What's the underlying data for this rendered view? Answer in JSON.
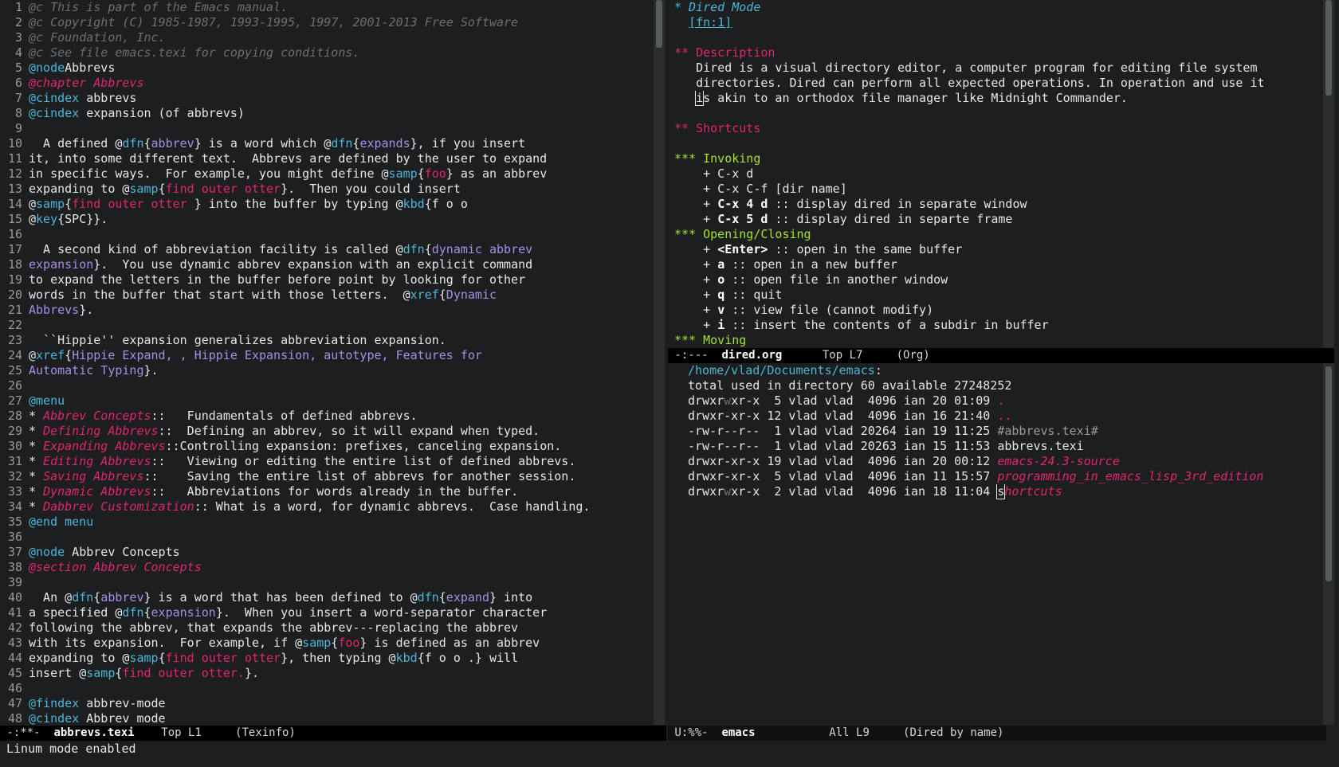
{
  "left_buffer": {
    "name": "abbrevs.texi",
    "lines": [
      [
        [
          "c-comment",
          "@c This is part of the Emacs manual."
        ]
      ],
      [
        [
          "c-comment",
          "@c Copyright (C) 1985-1987, 1993-1995, 1997, 2001-2013 Free Software"
        ]
      ],
      [
        [
          "c-comment",
          "@c Foundation, Inc."
        ]
      ],
      [
        [
          "c-comment",
          "@c See file emacs.texi for copying conditions."
        ]
      ],
      [
        [
          "c-cmd",
          "@node"
        ],
        [
          "",
          "Abbrevs"
        ]
      ],
      [
        [
          "c-chapter",
          "@chapter Abbrevs"
        ]
      ],
      [
        [
          "c-cmd",
          "@cindex"
        ],
        [
          "",
          " abbrevs"
        ]
      ],
      [
        [
          "c-cmd",
          "@cindex"
        ],
        [
          "",
          " expansion (of abbrevs)"
        ]
      ],
      [
        [
          "",
          ""
        ]
      ],
      [
        [
          "",
          "  A defined @"
        ],
        [
          "c-cmd",
          "dfn"
        ],
        [
          "",
          "{"
        ],
        [
          "c-arg",
          "abbrev"
        ],
        [
          "",
          "} is a word which @"
        ],
        [
          "c-cmd",
          "dfn"
        ],
        [
          "",
          "{"
        ],
        [
          "c-arg",
          "expands"
        ],
        [
          "",
          "}, if you insert"
        ]
      ],
      [
        [
          "",
          "it, into some different text.  Abbrevs are defined by the user to expand"
        ]
      ],
      [
        [
          "",
          "in specific ways.  For example, you might define @"
        ],
        [
          "c-cmd",
          "samp"
        ],
        [
          "",
          "{"
        ],
        [
          "c-str",
          "foo"
        ],
        [
          "",
          "} as an abbrev"
        ]
      ],
      [
        [
          "",
          "expanding to @"
        ],
        [
          "c-cmd",
          "samp"
        ],
        [
          "",
          "{"
        ],
        [
          "c-str",
          "find outer otter"
        ],
        [
          "",
          "}.  Then you could insert"
        ]
      ],
      [
        [
          "",
          "@"
        ],
        [
          "c-cmd",
          "samp"
        ],
        [
          "",
          "{"
        ],
        [
          "c-str",
          "find outer otter "
        ],
        [
          "",
          "} into the buffer by typing @"
        ],
        [
          "c-cmd",
          "kbd"
        ],
        [
          "",
          "{f o o"
        ]
      ],
      [
        [
          "",
          "@"
        ],
        [
          "c-cmd",
          "key"
        ],
        [
          "",
          "{SPC}}."
        ]
      ],
      [
        [
          "",
          ""
        ]
      ],
      [
        [
          "",
          "  A second kind of abbreviation facility is called @"
        ],
        [
          "c-cmd",
          "dfn"
        ],
        [
          "",
          "{"
        ],
        [
          "c-arg",
          "dynamic abbrev"
        ]
      ],
      [
        [
          "c-arg",
          "expansion"
        ],
        [
          "",
          "}.  You use dynamic abbrev expansion with an explicit command"
        ]
      ],
      [
        [
          "",
          "to expand the letters in the buffer before point by looking for other"
        ]
      ],
      [
        [
          "",
          "words in the buffer that start with those letters.  @"
        ],
        [
          "c-cmd",
          "xref"
        ],
        [
          "",
          "{"
        ],
        [
          "c-arg",
          "Dynamic"
        ]
      ],
      [
        [
          "c-arg",
          "Abbrevs"
        ],
        [
          "",
          "}."
        ]
      ],
      [
        [
          "",
          ""
        ]
      ],
      [
        [
          "",
          "  ``Hippie'' expansion generalizes abbreviation expansion."
        ]
      ],
      [
        [
          "",
          "@"
        ],
        [
          "c-cmd",
          "xref"
        ],
        [
          "",
          "{"
        ],
        [
          "c-arg",
          "Hippie Expand, , Hippie Expansion, autotype, Features for"
        ]
      ],
      [
        [
          "c-arg",
          "Automatic Typing"
        ],
        [
          "",
          "}."
        ]
      ],
      [
        [
          "",
          ""
        ]
      ],
      [
        [
          "c-cmd",
          "@menu"
        ]
      ],
      [
        [
          "",
          "* "
        ],
        [
          "c-menu-item",
          "Abbrev Concepts"
        ],
        [
          "",
          "::   Fundamentals of defined abbrevs."
        ]
      ],
      [
        [
          "",
          "* "
        ],
        [
          "c-menu-item",
          "Defining Abbrevs"
        ],
        [
          "",
          "::  Defining an abbrev, so it will expand when typed."
        ]
      ],
      [
        [
          "",
          "* "
        ],
        [
          "c-menu-item",
          "Expanding Abbrevs"
        ],
        [
          "",
          "::Controlling expansion: prefixes, canceling expansion."
        ]
      ],
      [
        [
          "",
          "* "
        ],
        [
          "c-menu-item",
          "Editing Abbrevs"
        ],
        [
          "",
          "::   Viewing or editing the entire list of defined abbrevs."
        ]
      ],
      [
        [
          "",
          "* "
        ],
        [
          "c-menu-item",
          "Saving Abbrevs"
        ],
        [
          "",
          "::    Saving the entire list of abbrevs for another session."
        ]
      ],
      [
        [
          "",
          "* "
        ],
        [
          "c-menu-item",
          "Dynamic Abbrevs"
        ],
        [
          "",
          "::   Abbreviations for words already in the buffer."
        ]
      ],
      [
        [
          "",
          "* "
        ],
        [
          "c-menu-item",
          "Dabbrev Customization"
        ],
        [
          "",
          ":: What is a word, for dynamic abbrevs.  Case handling."
        ]
      ],
      [
        [
          "c-cmd",
          "@end"
        ],
        [
          "",
          " "
        ],
        [
          "c-cmd",
          "menu"
        ]
      ],
      [
        [
          "",
          ""
        ]
      ],
      [
        [
          "c-cmd",
          "@node"
        ],
        [
          "",
          " Abbrev Concepts"
        ]
      ],
      [
        [
          "c-chapter",
          "@section Abbrev Concepts"
        ]
      ],
      [
        [
          "",
          ""
        ]
      ],
      [
        [
          "",
          "  An @"
        ],
        [
          "c-cmd",
          "dfn"
        ],
        [
          "",
          "{"
        ],
        [
          "c-arg",
          "abbrev"
        ],
        [
          "",
          "} is a word that has been defined to @"
        ],
        [
          "c-cmd",
          "dfn"
        ],
        [
          "",
          "{"
        ],
        [
          "c-arg",
          "expand"
        ],
        [
          "",
          "} into"
        ]
      ],
      [
        [
          "",
          "a specified @"
        ],
        [
          "c-cmd",
          "dfn"
        ],
        [
          "",
          "{"
        ],
        [
          "c-arg",
          "expansion"
        ],
        [
          "",
          "}.  When you insert a word-separator character"
        ]
      ],
      [
        [
          "",
          "following the abbrev, that expands the abbrev---replacing the abbrev"
        ]
      ],
      [
        [
          "",
          "with its expansion.  For example, if @"
        ],
        [
          "c-cmd",
          "samp"
        ],
        [
          "",
          "{"
        ],
        [
          "c-str",
          "foo"
        ],
        [
          "",
          "} is defined as an abbrev"
        ]
      ],
      [
        [
          "",
          "expanding to @"
        ],
        [
          "c-cmd",
          "samp"
        ],
        [
          "",
          "{"
        ],
        [
          "c-str",
          "find outer otter"
        ],
        [
          "",
          "}, then typing @"
        ],
        [
          "c-cmd",
          "kbd"
        ],
        [
          "",
          "{f o o .} will"
        ]
      ],
      [
        [
          "",
          "insert @"
        ],
        [
          "c-cmd",
          "samp"
        ],
        [
          "",
          "{"
        ],
        [
          "c-str",
          "find outer otter."
        ],
        [
          "",
          "}."
        ]
      ],
      [
        [
          "",
          ""
        ]
      ],
      [
        [
          "c-cmd",
          "@findex"
        ],
        [
          "",
          " abbrev-mode"
        ]
      ],
      [
        [
          "c-cmd",
          "@cindex"
        ],
        [
          "",
          " Abbrev mode"
        ]
      ]
    ]
  },
  "org_buffer": {
    "name": "dired.org",
    "lines": [
      [
        [
          "o-h1",
          "* Dired Mode"
        ]
      ],
      [
        [
          "",
          "  "
        ],
        [
          "o-link",
          "[fn:1]"
        ]
      ],
      [
        [
          "",
          ""
        ]
      ],
      [
        [
          "o-h2",
          "** Description"
        ]
      ],
      [
        [
          "",
          "   Dired is a visual directory editor, a computer program for editing file system"
        ]
      ],
      [
        [
          "",
          "   directories. Dired can perform all expected operations. In operation and use it"
        ]
      ],
      [
        [
          "",
          "   "
        ],
        [
          "cursor",
          "i"
        ],
        [
          "",
          "s akin to an orthodox file manager like Midnight Commander."
        ]
      ],
      [
        [
          "",
          ""
        ]
      ],
      [
        [
          "o-h2",
          "** Shortcuts"
        ]
      ],
      [
        [
          "",
          ""
        ]
      ],
      [
        [
          "o-h3",
          "*** Invoking"
        ]
      ],
      [
        [
          "",
          "    + C-x d"
        ]
      ],
      [
        [
          "",
          "    + C-x C-f [dir name]"
        ]
      ],
      [
        [
          "",
          "    + "
        ],
        [
          "bold",
          "C-x 4 d"
        ],
        [
          "",
          " :: display dired in separate window"
        ]
      ],
      [
        [
          "",
          "    + "
        ],
        [
          "bold",
          "C-x 5 d"
        ],
        [
          "",
          " :: display dired in separte frame"
        ]
      ],
      [
        [
          "o-h3",
          "*** Opening/Closing"
        ]
      ],
      [
        [
          "",
          "    + "
        ],
        [
          "bold",
          "<Enter>"
        ],
        [
          "",
          " :: open in the same buffer"
        ]
      ],
      [
        [
          "",
          "    + "
        ],
        [
          "bold",
          "a"
        ],
        [
          "",
          " :: open in a new buffer"
        ]
      ],
      [
        [
          "",
          "    + "
        ],
        [
          "bold",
          "o"
        ],
        [
          "",
          " :: open file in another window"
        ]
      ],
      [
        [
          "",
          "    + "
        ],
        [
          "bold",
          "q"
        ],
        [
          "",
          " :: quit"
        ]
      ],
      [
        [
          "",
          "    + "
        ],
        [
          "bold",
          "v"
        ],
        [
          "",
          " :: view file (cannot modify)"
        ]
      ],
      [
        [
          "",
          "    + "
        ],
        [
          "bold",
          "i"
        ],
        [
          "",
          " :: insert the contents of a subdir in buffer"
        ]
      ],
      [
        [
          "o-h3",
          "*** Moving"
        ]
      ]
    ]
  },
  "dired_buffer": {
    "name": "emacs",
    "lines": [
      [
        [
          "d-dir",
          "/home/vlad/Documents/emacs"
        ],
        [
          "",
          ":"
        ]
      ],
      [
        [
          "",
          "total used in directory 60 available 27248252"
        ]
      ],
      [
        [
          "",
          "drwxr"
        ],
        [
          "d-gray",
          "w"
        ],
        [
          "",
          "xr-x  5 vlad vlad  4096 ian 20 01:09 "
        ],
        [
          "d-dot",
          "."
        ]
      ],
      [
        [
          "",
          "drwxr-xr-x 12 vlad vlad  4096 ian 16 21:40 "
        ],
        [
          "d-dot",
          ".."
        ]
      ],
      [
        [
          "",
          "-rw-r--r--  1 vlad vlad 20264 ian 19 11:25 "
        ],
        [
          "d-backup",
          "#abbrevs.texi#"
        ]
      ],
      [
        [
          "",
          "-rw-r--r--  1 vlad vlad 20263 ian 15 11:53 abbrevs.texi"
        ]
      ],
      [
        [
          "",
          "drwxr-xr-x 19 vlad vlad  4096 ian 20 00:12 "
        ],
        [
          "d-subdir",
          "emacs-24.3-source"
        ]
      ],
      [
        [
          "",
          "drwxr-xr-x  5 vlad vlad  4096 ian 11 15:57 "
        ],
        [
          "d-subdir",
          "programming_in_emacs_lisp_3rd_edition"
        ]
      ],
      [
        [
          "",
          "drwxr"
        ],
        [
          "d-gray",
          "w"
        ],
        [
          "",
          "xr-x  2 vlad vlad  4096 ian 18 11:04 "
        ],
        [
          "cursor",
          "s"
        ],
        [
          "d-subdir",
          "hortcuts"
        ]
      ]
    ]
  },
  "modelines": {
    "left": {
      "status": " -:**-  ",
      "buffer": "abbrevs.texi",
      "position": "    Top L1",
      "mode": "     (Texinfo)"
    },
    "org": {
      "status": " -:---  ",
      "buffer": "dired.org",
      "position": "      Top L7",
      "mode": "     (Org)"
    },
    "dired": {
      "status": " U:%%-  ",
      "buffer": "emacs",
      "position": "           All L9",
      "mode": "     (Dired by name)"
    }
  },
  "minibuffer": "Linum mode enabled"
}
